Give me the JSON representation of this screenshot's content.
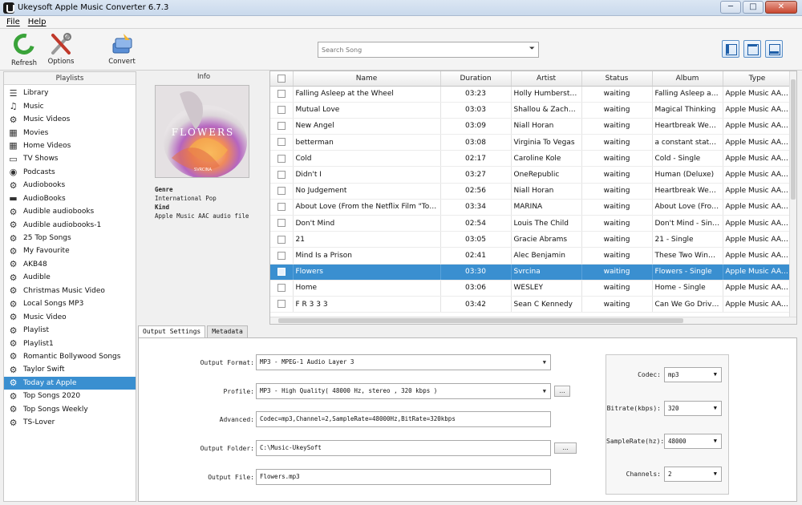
{
  "window": {
    "title": "Ukeysoft Apple Music Converter 6.7.3",
    "minimize": "─",
    "maximize": "□",
    "close": "✕"
  },
  "menu": {
    "file": "File",
    "help": "Help"
  },
  "toolbar": {
    "refresh": "Refresh",
    "options": "Options",
    "convert": "Convert",
    "search_placeholder": "Search Song",
    "search_arrow": "⏷"
  },
  "sidebar": {
    "header": "Playlists",
    "items": [
      {
        "label": "Library",
        "icon": "list-icon"
      },
      {
        "label": "Music",
        "icon": "music-note-icon"
      },
      {
        "label": "Music Videos",
        "icon": "gear-icon"
      },
      {
        "label": "Movies",
        "icon": "film-icon"
      },
      {
        "label": "Home Videos",
        "icon": "film-icon"
      },
      {
        "label": "TV Shows",
        "icon": "tv-icon"
      },
      {
        "label": "Podcasts",
        "icon": "podcast-icon"
      },
      {
        "label": "Audiobooks",
        "icon": "gear-icon"
      },
      {
        "label": "AudioBooks",
        "icon": "folder-icon"
      },
      {
        "label": "Audible audiobooks",
        "icon": "gear-icon"
      },
      {
        "label": "Audible audiobooks-1",
        "icon": "gear-icon"
      },
      {
        "label": "25 Top Songs",
        "icon": "gear-icon"
      },
      {
        "label": "My Favourite",
        "icon": "gear-icon"
      },
      {
        "label": "AKB48",
        "icon": "gear-icon"
      },
      {
        "label": "Audible",
        "icon": "gear-icon"
      },
      {
        "label": "Christmas Music Video",
        "icon": "gear-icon"
      },
      {
        "label": "Local Songs MP3",
        "icon": "gear-icon"
      },
      {
        "label": "Music Video",
        "icon": "gear-icon"
      },
      {
        "label": "Playlist",
        "icon": "gear-icon"
      },
      {
        "label": "Playlist1",
        "icon": "gear-icon"
      },
      {
        "label": "Romantic Bollywood Songs",
        "icon": "gear-icon"
      },
      {
        "label": "Taylor Swift",
        "icon": "gear-icon"
      },
      {
        "label": "Today at Apple",
        "icon": "gear-icon",
        "selected": true
      },
      {
        "label": "Top Songs 2020",
        "icon": "gear-icon"
      },
      {
        "label": "Top Songs Weekly",
        "icon": "gear-icon"
      },
      {
        "label": "TS-Lover",
        "icon": "gear-icon"
      }
    ]
  },
  "info": {
    "header": "Info",
    "album_title": "FLOWERS",
    "album_artist": "SVRCINA",
    "genre_key": "Genre",
    "genre_value": "International Pop",
    "kind_key": "Kind",
    "kind_value": "Apple Music AAC audio file"
  },
  "table": {
    "columns": [
      "",
      "Name",
      "Duration",
      "Artist",
      "Status",
      "Album",
      "Type"
    ],
    "rows": [
      [
        "Falling Asleep at the Wheel",
        "03:23",
        "Holly Humberstone",
        "waiting",
        "Falling Asleep at the ...",
        "Apple Music AAC ..."
      ],
      [
        "Mutual Love",
        "03:03",
        "Shallou & Zachary ...",
        "waiting",
        "Magical Thinking",
        "Apple Music AAC ..."
      ],
      [
        "New Angel",
        "03:09",
        "Niall Horan",
        "waiting",
        "Heartbreak Weather",
        "Apple Music AAC ..."
      ],
      [
        "betterman",
        "03:08",
        "Virginia To Vegas",
        "waiting",
        "a constant state of ...",
        "Apple Music AAC ..."
      ],
      [
        "Cold",
        "02:17",
        "Caroline Kole",
        "waiting",
        "Cold - Single",
        "Apple Music AAC ..."
      ],
      [
        "Didn't I",
        "03:27",
        "OneRepublic",
        "waiting",
        "Human (Deluxe)",
        "Apple Music AAC ..."
      ],
      [
        "No Judgement",
        "02:56",
        "Niall Horan",
        "waiting",
        "Heartbreak Weather",
        "Apple Music AAC ..."
      ],
      [
        "About Love (From the Netflix Film \"To All ...",
        "03:34",
        "MARINA",
        "waiting",
        "About Love (From ...",
        "Apple Music AAC ..."
      ],
      [
        "Don't Mind",
        "02:54",
        "Louis The Child",
        "waiting",
        "Don't Mind - Single",
        "Apple Music AAC ..."
      ],
      [
        "21",
        "03:05",
        "Gracie Abrams",
        "waiting",
        "21 - Single",
        "Apple Music AAC ..."
      ],
      [
        "Mind Is a Prison",
        "02:41",
        "Alec Benjamin",
        "waiting",
        "These Two Windows",
        "Apple Music AAC ..."
      ],
      [
        "Flowers",
        "03:30",
        "Svrcina",
        "waiting",
        "Flowers - Single",
        "Apple Music AAC ..."
      ],
      [
        "Home",
        "03:06",
        "WESLEY",
        "waiting",
        "Home - Single",
        "Apple Music AAC ..."
      ],
      [
        "F R 3 3 3",
        "03:42",
        "Sean C Kennedy",
        "waiting",
        "Can We Go Drivin...",
        "Apple Music AAC ..."
      ]
    ],
    "selected_index": 11
  },
  "tabs": {
    "output": "Output Settings",
    "metadata": "Metadata"
  },
  "settings": {
    "format_label": "Output Format:",
    "format_value": "MP3 - MPEG-1 Audio Layer 3",
    "profile_label": "Profile:",
    "profile_value": "MP3 - High Quality( 48000 Hz, stereo , 320 kbps  )",
    "profile_btn": "...",
    "advanced_label": "Advanced:",
    "advanced_value": "Codec=mp3,Channel=2,SampleRate=48000Hz,BitRate=320kbps",
    "folder_label": "Output Folder:",
    "folder_value": "C:\\Music-UkeySoft",
    "folder_btn": "...",
    "file_label": "Output File:",
    "file_value": "Flowers.mp3",
    "codec_label": "Codec:",
    "codec_value": "mp3",
    "bitrate_label": "Bitrate(kbps):",
    "bitrate_value": "320",
    "samplerate_label": "SampleRate(hz):",
    "samplerate_value": "48000",
    "channels_label": "Channels:",
    "channels_value": "2",
    "dropdown_glyph": "▼"
  }
}
